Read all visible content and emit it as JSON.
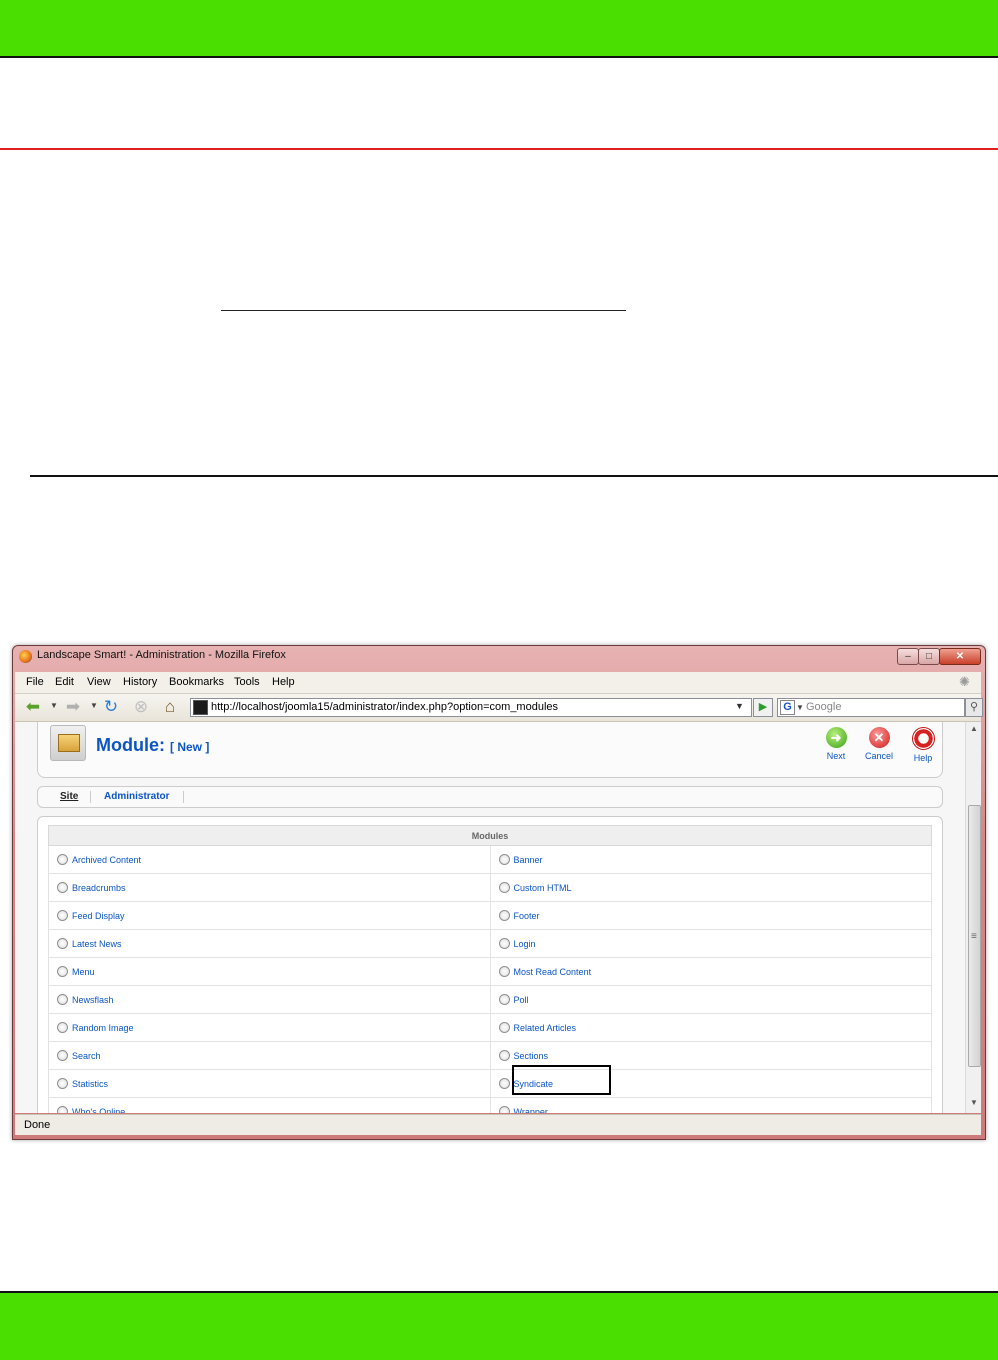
{
  "window": {
    "title": "Landscape Smart! - Administration - Mozilla Firefox",
    "caption_buttons": {
      "minimize": "–",
      "maximize": "□",
      "close": "✕"
    }
  },
  "menu": [
    {
      "label": "File"
    },
    {
      "label": "Edit"
    },
    {
      "label": "View"
    },
    {
      "label": "History"
    },
    {
      "label": "Bookmarks"
    },
    {
      "label": "Tools"
    },
    {
      "label": "Help"
    }
  ],
  "nav": {
    "url": "http://localhost/joomla15/administrator/index.php?option=com_modules",
    "search_placeholder": "Google",
    "search_engine_glyph": "G"
  },
  "toolbar": {
    "title": "Module:",
    "subtitle": "[ New ]",
    "next_label": "Next",
    "cancel_label": "Cancel",
    "help_label": "Help"
  },
  "tabs": [
    {
      "label": "Site",
      "active": true
    },
    {
      "label": "Administrator",
      "active": false
    }
  ],
  "modules": {
    "header": "Modules",
    "rows": [
      [
        "Archived Content",
        "Banner"
      ],
      [
        "Breadcrumbs",
        "Custom HTML"
      ],
      [
        "Feed Display",
        "Footer"
      ],
      [
        "Latest News",
        "Login"
      ],
      [
        "Menu",
        "Most Read Content"
      ],
      [
        "Newsflash",
        "Poll"
      ],
      [
        "Random Image",
        "Related Articles"
      ],
      [
        "Search",
        "Sections"
      ],
      [
        "Statistics",
        "Syndicate"
      ],
      [
        "Who's Online",
        "Wrapper"
      ]
    ],
    "highlighted": "Syndicate"
  },
  "status": {
    "text": "Done"
  },
  "colors": {
    "page_band": "#4bdf00",
    "rule_red": "#e02020",
    "link_blue": "#0b55c4"
  }
}
